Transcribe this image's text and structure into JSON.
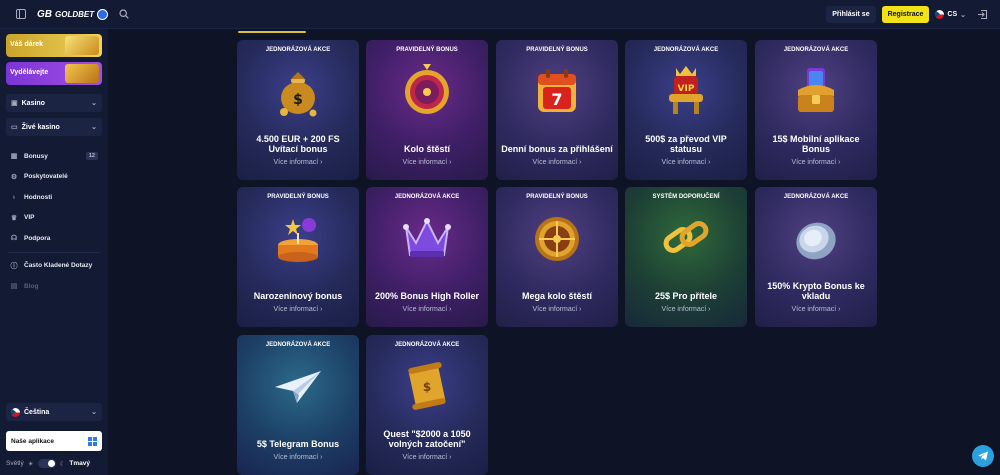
{
  "topbar": {
    "logo_mark": "GB",
    "logo_text": "GOLDBET",
    "login_label": "Přihlásit se",
    "register_label": "Registrace",
    "lang_code": "CS"
  },
  "sidebar": {
    "promo_gift": "Váš dárek",
    "promo_earn": "Vydělávejte",
    "casino_label": "Kasino",
    "live_casino_label": "Živé kasino",
    "nav": [
      {
        "label": "Bonusy",
        "badge": "12",
        "icon": "gift-icon"
      },
      {
        "label": "Poskytovatelé",
        "icon": "providers-icon"
      },
      {
        "label": "Hodnosti",
        "icon": "medal-icon"
      },
      {
        "label": "VIP",
        "icon": "crown-icon"
      },
      {
        "label": "Podpora",
        "icon": "headset-icon"
      },
      {
        "label": "Často Kladené Dotazy",
        "icon": "info-icon"
      },
      {
        "label": "Blog",
        "icon": "blog-icon"
      }
    ],
    "language_label": "Čeština",
    "app_label": "Naše aplikace",
    "theme_light": "Světlý",
    "theme_dark": "Tmavý"
  },
  "cards": [
    {
      "tag": "JEDNORÁZOVÁ AKCE",
      "title": "4.500 EUR + 200 FS Uvítací bonus",
      "more": "Více informací",
      "icon": "money-bag-icon"
    },
    {
      "tag": "PRAVIDELNÝ BONUS",
      "title": "Kolo štěstí",
      "more": "Více informací",
      "icon": "wheel-icon"
    },
    {
      "tag": "PRAVIDELNÝ BONUS",
      "title": "Denní bonus za přihlášení",
      "more": "Více informací",
      "icon": "calendar-icon"
    },
    {
      "tag": "JEDNORÁZOVÁ AKCE",
      "title": "500$ za převod VIP statusu",
      "more": "Více informací",
      "icon": "vip-throne-icon"
    },
    {
      "tag": "JEDNORÁZOVÁ AKCE",
      "title": "15$ Mobilní aplikace Bonus",
      "more": "Více informací",
      "icon": "treasure-chest-icon"
    },
    {
      "tag": "PRAVIDELNÝ BONUS",
      "title": "Narozeninový bonus",
      "more": "Více informací",
      "icon": "cake-icon"
    },
    {
      "tag": "JEDNORÁZOVÁ AKCE",
      "title": "200% Bonus High Roller",
      "more": "Více informací",
      "icon": "crown-icon"
    },
    {
      "tag": "PRAVIDELNÝ BONUS",
      "title": "Mega kolo štěstí",
      "more": "Více informací",
      "icon": "wheel-icon"
    },
    {
      "tag": "SYSTÉM DOPORUČENÍ",
      "title": "25$ Pro přítele",
      "more": "Více informací",
      "icon": "chain-link-icon"
    },
    {
      "tag": "JEDNORÁZOVÁ AKCE",
      "title": "150% Krypto Bonus ke vkladu",
      "more": "Více informací",
      "icon": "coin-icon"
    },
    {
      "tag": "JEDNORÁZOVÁ AKCE",
      "title": "5$ Telegram Bonus",
      "more": "Více informací",
      "icon": "paper-plane-icon"
    },
    {
      "tag": "JEDNORÁZOVÁ AKCE",
      "title": "Quest \"$2000 a 1050 volných zatočení\"",
      "more": "Více informací",
      "icon": "scroll-icon"
    }
  ],
  "colors": {
    "accent_yellow": "#f2e21a",
    "background": "#0e1326",
    "panel": "#131a33",
    "telegram": "#2aa1de"
  }
}
